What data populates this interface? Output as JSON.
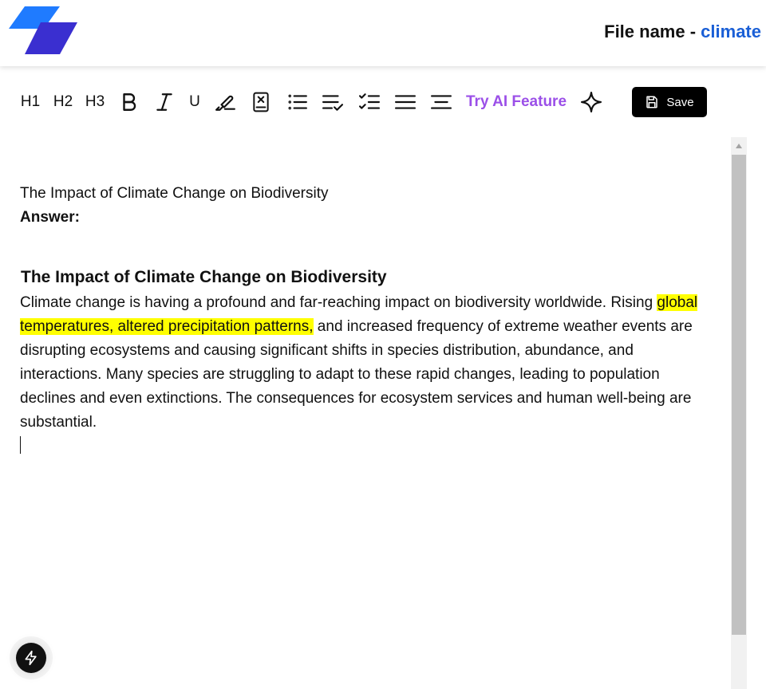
{
  "header": {
    "file_label": "File name - ",
    "file_name": "climate"
  },
  "toolbar": {
    "h1": "H1",
    "h2": "H2",
    "h3": "H3",
    "underline": "U",
    "ai_label": "Try AI Feature",
    "save_label": "Save",
    "icons": [
      "bold-icon",
      "italic-icon",
      "highlighter-icon",
      "clear-format-icon",
      "bullet-list-icon",
      "ordered-check-list-icon",
      "check-list-icon",
      "align-justify-icon",
      "align-center-icon",
      "sparkle-icon",
      "save-icon"
    ]
  },
  "document": {
    "question": "The Impact of Climate Change on Biodiversity",
    "answer_label": "Answer:",
    "section_title": "The Impact of Climate Change on Biodiversity",
    "para_start": "Climate change is having a profound and far-reaching impact on biodiversity worldwide. Rising ",
    "para_highlight": "global temperatures, altered precipitation patterns,",
    "para_rest": " and increased frequency of extreme weather events are disrupting ecosystems and causing significant shifts in species distribution, abundance, and interactions. Many species are struggling to adapt to these rapid changes, leading to population declines and even extinctions. The consequences for ecosystem services and human well-being are substantial."
  },
  "colors": {
    "accent_blue": "#1a5fd6",
    "ai_purple": "#9b4fe8",
    "highlight": "#ffff00",
    "logo_top": "#1f7bff",
    "logo_bottom": "#3a2fd0"
  }
}
